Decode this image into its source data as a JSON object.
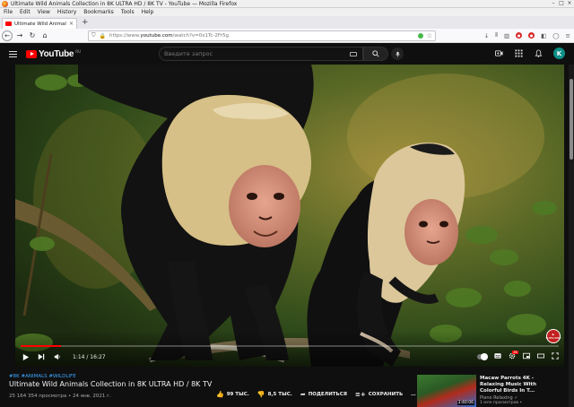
{
  "window": {
    "title": "Ultimate Wild Animals Collection in 8K ULTRA HD / 8K TV - YouTube — Mozilla Firefox"
  },
  "menu": [
    "File",
    "Edit",
    "View",
    "History",
    "Bookmarks",
    "Tools",
    "Help"
  ],
  "tab": {
    "title": "Ultimate Wild Animals Colle",
    "close": "×",
    "new_tab": "+"
  },
  "urlbar": {
    "prefix": "https://www.",
    "host": "youtube.com",
    "path": "/watch?v=0x1Tc-2Fr5g"
  },
  "youtube": {
    "logo_text": "YouTube",
    "logo_region": "RU",
    "search_placeholder": "Введите запрос",
    "avatar_letter": "K"
  },
  "player": {
    "time": "1:14 / 16:27",
    "progress": 0.075,
    "watermark": "SUBSCRIBE"
  },
  "video": {
    "hashtags": "#8K #ANIMALS #WILDLIFE",
    "title": "Ultimate Wild Animals Collection in 8K ULTRA HD / 8K TV",
    "meta": "25 164 354 просмотра • 24 янв. 2021 г.",
    "likes": "99 ТЫС.",
    "dislikes": "8,5 ТЫС.",
    "share": "ПОДЕЛИТЬСЯ",
    "save": "СОХРАНИТЬ",
    "more": "…"
  },
  "recommended": {
    "title": "Macaw Parrots 4K - Relaxing Music With Colorful Birds In T...",
    "channel": "Piano Relaxing ✓",
    "views": "1 млн просмотров •",
    "duration": "3:40:06"
  },
  "colors": {
    "youtube_red": "#ff0000",
    "link_blue": "#3ea6ff",
    "background": "#0f0f0f"
  }
}
